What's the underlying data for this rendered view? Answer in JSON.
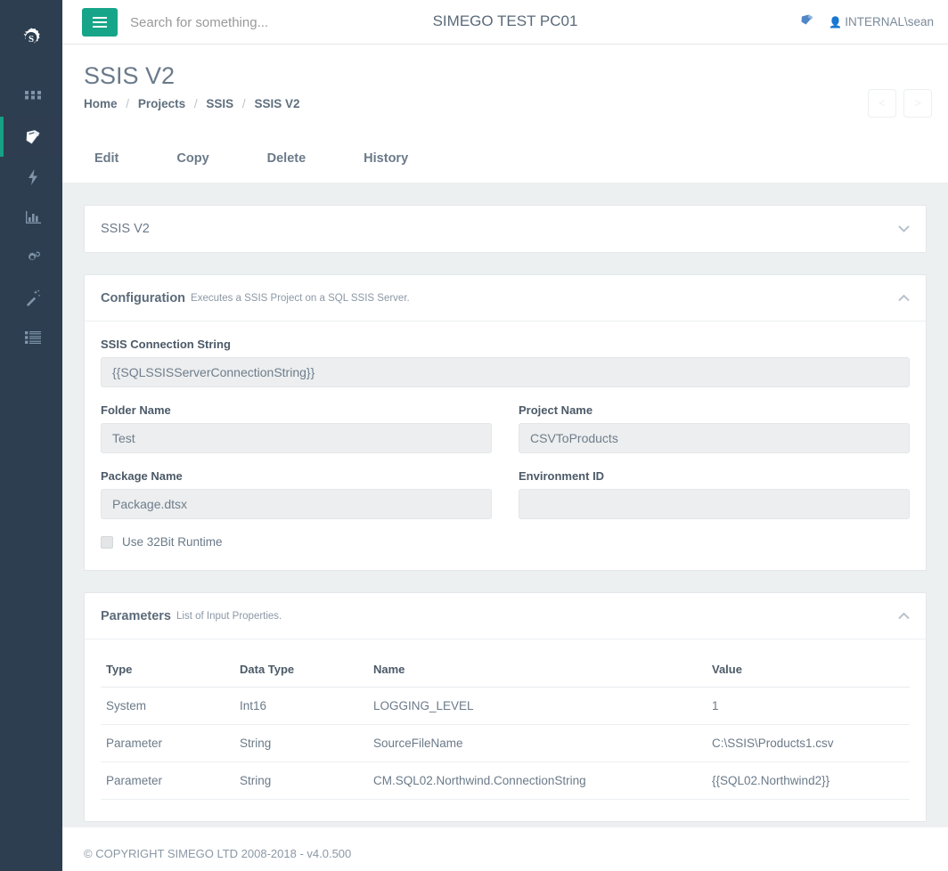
{
  "brand": {
    "logo_icon": "gear-s-logo"
  },
  "colors": {
    "sidebar_bg": "#2c3e50",
    "accent_green": "#16a085",
    "menu_button": "#17a589",
    "page_bg": "#ecf0f1",
    "text_muted": "#8b98a5"
  },
  "sidebar": {
    "items": [
      {
        "icon": "grid-icon",
        "name": "sidebar-item-dashboard",
        "active": false
      },
      {
        "icon": "book-icon",
        "name": "sidebar-item-projects",
        "active": true
      },
      {
        "icon": "lightning-icon",
        "name": "sidebar-item-automation",
        "active": false
      },
      {
        "icon": "bar-chart-icon",
        "name": "sidebar-item-reports",
        "active": false
      },
      {
        "icon": "gears-icon",
        "name": "sidebar-item-settings",
        "active": false
      },
      {
        "icon": "magic-wand-icon",
        "name": "sidebar-item-tools",
        "active": false
      },
      {
        "icon": "list-icon",
        "name": "sidebar-item-logs",
        "active": false
      }
    ]
  },
  "topbar": {
    "menu_icon": "hamburger-icon",
    "search_placeholder": "Search for something...",
    "search_value": "",
    "title": "SIMEGO TEST PC01",
    "notebook_icon": "book-icon",
    "user_icon": "user-icon",
    "user": "INTERNAL\\sean"
  },
  "page": {
    "title": "SSIS V2",
    "breadcrumb": [
      {
        "label": "Home"
      },
      {
        "label": "Projects"
      },
      {
        "label": "SSIS"
      },
      {
        "label": "SSIS V2"
      }
    ],
    "breadcrumb_separator": "/",
    "pager": {
      "prev": "<",
      "next": ">"
    },
    "tabs": [
      {
        "label": "Edit",
        "name": "tab-edit"
      },
      {
        "label": "Copy",
        "name": "tab-copy"
      },
      {
        "label": "Delete",
        "name": "tab-delete"
      },
      {
        "label": "History",
        "name": "tab-history"
      }
    ]
  },
  "panels": {
    "project": {
      "title": "SSIS V2",
      "collapsed": true,
      "chevron": "chevron-down-icon"
    },
    "configuration": {
      "title": "Configuration",
      "subtitle": "Executes a SSIS Project on a SQL SSIS Server.",
      "collapsed": false,
      "chevron": "chevron-up-icon",
      "fields": {
        "connection_string": {
          "label": "SSIS Connection String",
          "value": "{{SQLSSISServerConnectionString}}"
        },
        "folder_name": {
          "label": "Folder Name",
          "value": "Test"
        },
        "project_name": {
          "label": "Project Name",
          "value": "CSVToProducts"
        },
        "package_name": {
          "label": "Package Name",
          "value": "Package.dtsx"
        },
        "environment_id": {
          "label": "Environment ID",
          "value": ""
        },
        "use_32bit": {
          "label": "Use 32Bit Runtime",
          "checked": false
        }
      }
    },
    "parameters": {
      "title": "Parameters",
      "subtitle": "List of Input Properties.",
      "collapsed": false,
      "chevron": "chevron-up-icon",
      "columns": [
        "Type",
        "Data Type",
        "Name",
        "Value"
      ],
      "rows": [
        {
          "type": "System",
          "data_type": "Int16",
          "name": "LOGGING_LEVEL",
          "value": "1"
        },
        {
          "type": "Parameter",
          "data_type": "String",
          "name": "SourceFileName",
          "value": "C:\\SSIS\\Products1.csv"
        },
        {
          "type": "Parameter",
          "data_type": "String",
          "name": "CM.SQL02.Northwind.ConnectionString",
          "value": "{{SQL02.Northwind2}}"
        }
      ]
    }
  },
  "footer": {
    "text": "© COPYRIGHT SIMEGO LTD 2008-2018 - v4.0.500"
  }
}
